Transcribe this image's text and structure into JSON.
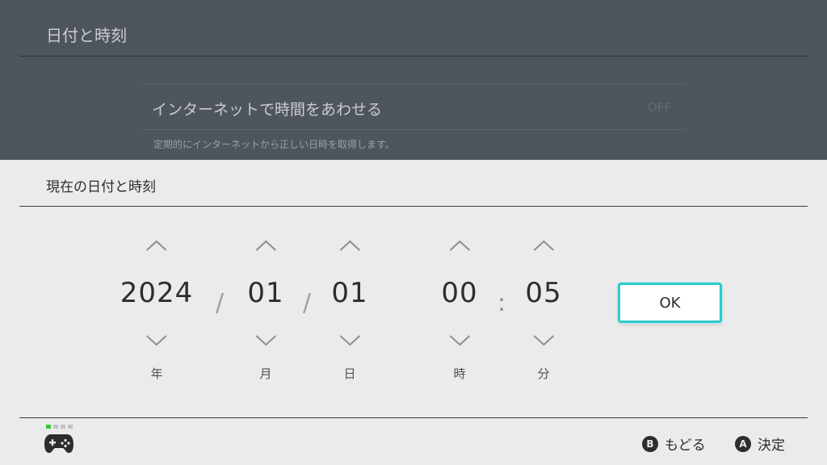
{
  "background": {
    "title": "日付と時刻",
    "setting": {
      "label": "インターネットで時間をあわせる",
      "value": "OFF",
      "description": "定期的にインターネットから正しい日時を取得します。"
    }
  },
  "dialog": {
    "title": "現在の日付と時刻",
    "date_separator": "/",
    "time_separator": ":",
    "fields": {
      "year": {
        "value": "2024",
        "unit": "年"
      },
      "month": {
        "value": "01",
        "unit": "月"
      },
      "day": {
        "value": "01",
        "unit": "日"
      },
      "hour": {
        "value": "00",
        "unit": "時"
      },
      "minute": {
        "value": "05",
        "unit": "分"
      }
    },
    "ok_label": "OK"
  },
  "footer": {
    "back": {
      "button": "B",
      "label": "もどる"
    },
    "confirm": {
      "button": "A",
      "label": "決定"
    }
  },
  "colors": {
    "focus": "#2ec9c9",
    "player_indicator": "#3ac83a",
    "dim_background": "#4f555d",
    "panel_background": "#ebebeb"
  },
  "icons": [
    "chevron-up-icon",
    "chevron-down-icon",
    "controller-icon"
  ]
}
